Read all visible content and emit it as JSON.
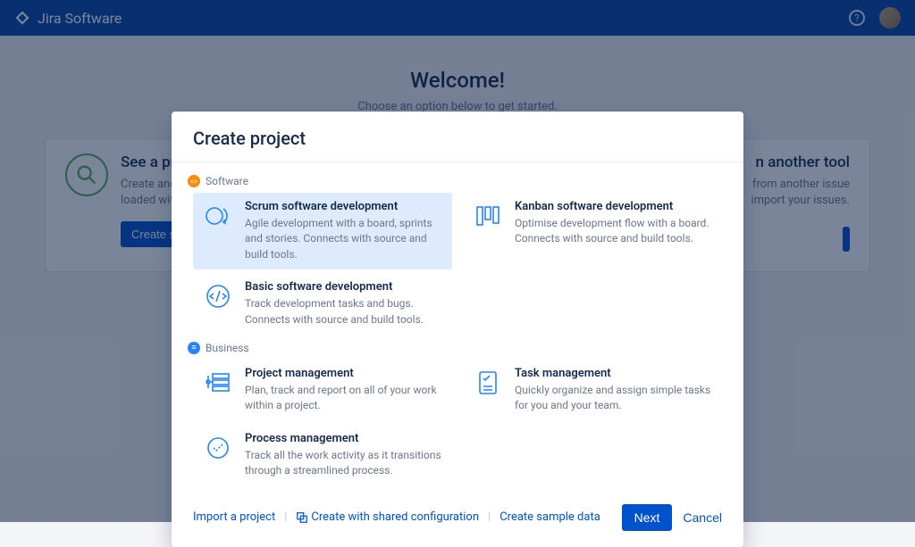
{
  "brand": "Jira Software",
  "welcome": {
    "title": "Welcome!",
    "subtitle": "Choose an option below to get started."
  },
  "bg": {
    "left": {
      "title": "See a pro",
      "desc1": "Create and ex",
      "desc2": "loaded with s",
      "button": "Create sam"
    },
    "right": {
      "title": "n another tool",
      "desc1": "from another issue",
      "desc2": "import your issues."
    }
  },
  "modal": {
    "title": "Create project",
    "sections": {
      "software": "Software",
      "business": "Business"
    },
    "options": {
      "scrum": {
        "title": "Scrum software development",
        "desc": "Agile development with a board, sprints and stories. Connects with source and build tools."
      },
      "kanban": {
        "title": "Kanban software development",
        "desc": "Optimise development flow with a board. Connects with source and build tools."
      },
      "basic": {
        "title": "Basic software development",
        "desc": "Track development tasks and bugs. Connects with source and build tools."
      },
      "project": {
        "title": "Project management",
        "desc": "Plan, track and report on all of your work within a project."
      },
      "task": {
        "title": "Task management",
        "desc": "Quickly organize and assign simple tasks for you and your team."
      },
      "process": {
        "title": "Process management",
        "desc": "Track all the work activity as it transitions through a streamlined process."
      }
    },
    "footer": {
      "import": "Import a project",
      "shared": "Create with shared configuration",
      "sample": "Create sample data",
      "next": "Next",
      "cancel": "Cancel"
    }
  }
}
